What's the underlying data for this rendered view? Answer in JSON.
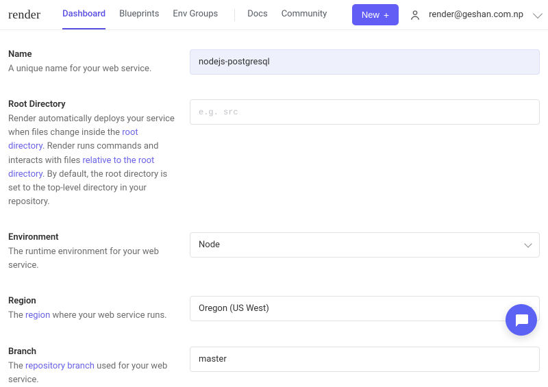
{
  "header": {
    "logo": "render",
    "nav": {
      "dashboard": "Dashboard",
      "blueprints": "Blueprints",
      "env_groups": "Env Groups",
      "docs": "Docs",
      "community": "Community"
    },
    "new_button": "New",
    "user_email": "render@geshan.com.np"
  },
  "form": {
    "name": {
      "label": "Name",
      "desc": "A unique name for your web service.",
      "value": "nodejs-postgresql"
    },
    "root_dir": {
      "label": "Root Directory",
      "desc_pre": "Render automatically deploys your service when files change inside the ",
      "link1": "root directory",
      "desc_mid1": ". Render runs commands and interacts with files ",
      "link2": "relative to the root directory",
      "desc_mid2": ". By default, the root directory is set to the top-level directory in your repository.",
      "placeholder": "e.g. src"
    },
    "environment": {
      "label": "Environment",
      "desc": "The runtime environment for your web service.",
      "value": "Node"
    },
    "region": {
      "label": "Region",
      "desc_pre": "The ",
      "link": "region",
      "desc_post": " where your web service runs.",
      "value": "Oregon (US West)"
    },
    "branch": {
      "label": "Branch",
      "desc_pre": "The ",
      "link": "repository branch",
      "desc_post": " used for your web service.",
      "value": "master"
    }
  }
}
